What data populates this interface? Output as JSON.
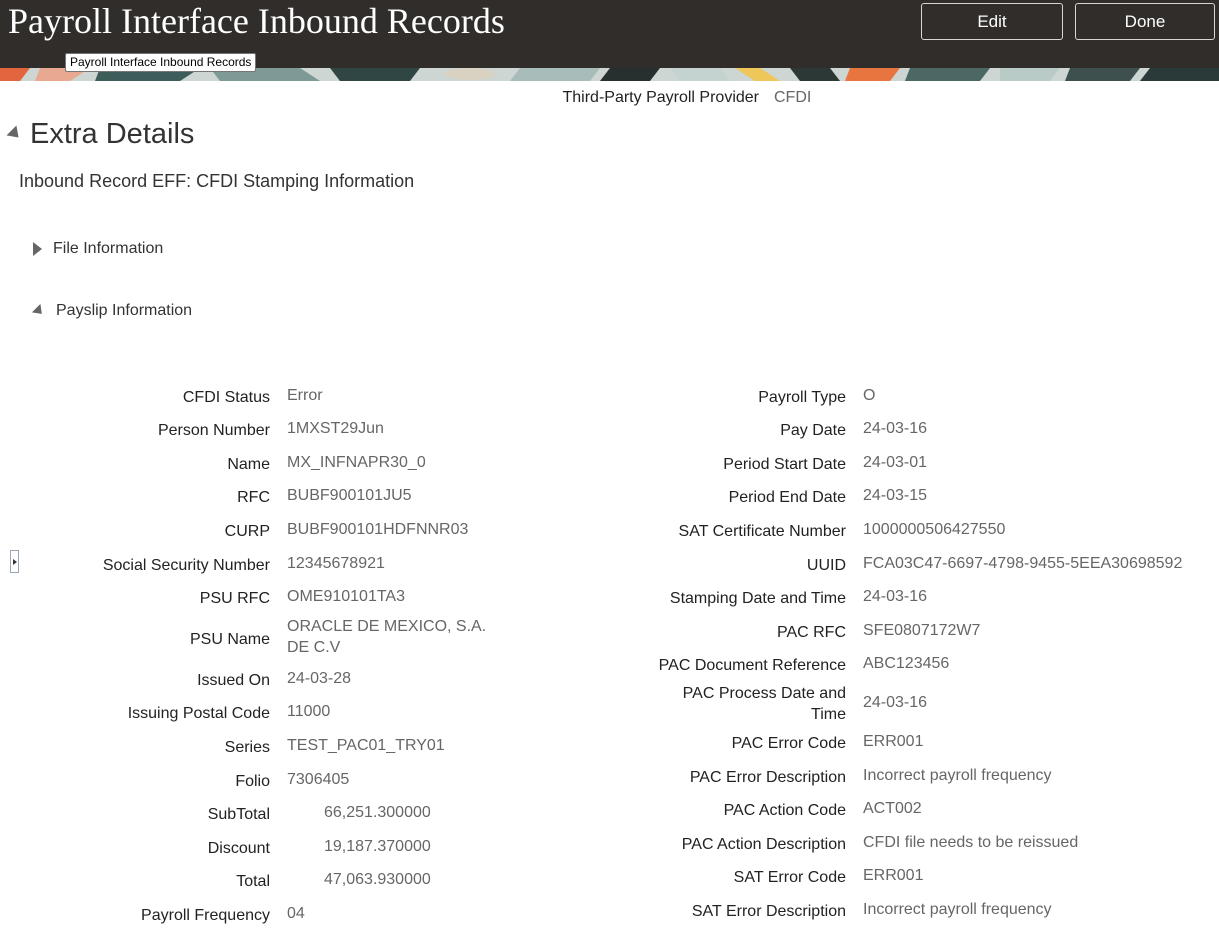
{
  "header": {
    "title": "Payroll Interface Inbound Records",
    "edit_label": "Edit",
    "done_label": "Done",
    "tooltip": "Payroll Interface Inbound Records"
  },
  "provider": {
    "label": "Third-Party Payroll Provider",
    "value": "CFDI"
  },
  "section": {
    "title": "Extra Details",
    "eff_title": "Inbound Record EFF: CFDI Stamping Information",
    "file_info_label": "File Information",
    "payslip_info_label": "Payslip Information"
  },
  "payslip": {
    "left": [
      {
        "label": "CFDI Status",
        "value": "Error"
      },
      {
        "label": "Person Number",
        "value": "1MXST29Jun"
      },
      {
        "label": "Name",
        "value": "MX_INFNAPR30_0"
      },
      {
        "label": "RFC",
        "value": "BUBF900101JU5"
      },
      {
        "label": "CURP",
        "value": "BUBF900101HDFNNR03"
      },
      {
        "label": "Social Security Number",
        "value": "12345678921"
      },
      {
        "label": "PSU RFC",
        "value": "OME910101TA3"
      },
      {
        "label": "PSU Name",
        "value": "ORACLE DE MEXICO, S.A. DE C.V"
      },
      {
        "label": "Issued On",
        "value": "24-03-28"
      },
      {
        "label": "Issuing Postal Code",
        "value": "11000"
      },
      {
        "label": "Series",
        "value": "TEST_PAC01_TRY01"
      },
      {
        "label": "Folio",
        "value": "7306405"
      },
      {
        "label": "SubTotal",
        "value": "66,251.300000"
      },
      {
        "label": "Discount",
        "value": "19,187.370000"
      },
      {
        "label": "Total",
        "value": "47,063.930000"
      },
      {
        "label": "Payroll Frequency",
        "value": "04"
      }
    ],
    "right": [
      {
        "label": "Payroll Type",
        "value": "O"
      },
      {
        "label": "Pay Date",
        "value": "24-03-16"
      },
      {
        "label": "Period Start Date",
        "value": "24-03-01"
      },
      {
        "label": "Period End Date",
        "value": "24-03-15"
      },
      {
        "label": "SAT Certificate Number",
        "value": "1000000506427550"
      },
      {
        "label": "UUID",
        "value": "FCA03C47-6697-4798-9455-5EEA30698592"
      },
      {
        "label": "Stamping Date and Time",
        "value": "24-03-16"
      },
      {
        "label": "PAC RFC",
        "value": "SFE0807172W7"
      },
      {
        "label": "PAC Document Reference",
        "value": "ABC123456"
      },
      {
        "label": "PAC Process Date and Time",
        "value": "24-03-16"
      },
      {
        "label": "PAC Error Code",
        "value": "ERR001"
      },
      {
        "label": "PAC Error Description",
        "value": "Incorrect payroll frequency"
      },
      {
        "label": "PAC Action Code",
        "value": "ACT002"
      },
      {
        "label": "PAC Action Description",
        "value": "CFDI file needs to be reissued"
      },
      {
        "label": "SAT Error Code",
        "value": "ERR001"
      },
      {
        "label": "SAT Error Description",
        "value": "Incorrect payroll frequency"
      }
    ]
  }
}
